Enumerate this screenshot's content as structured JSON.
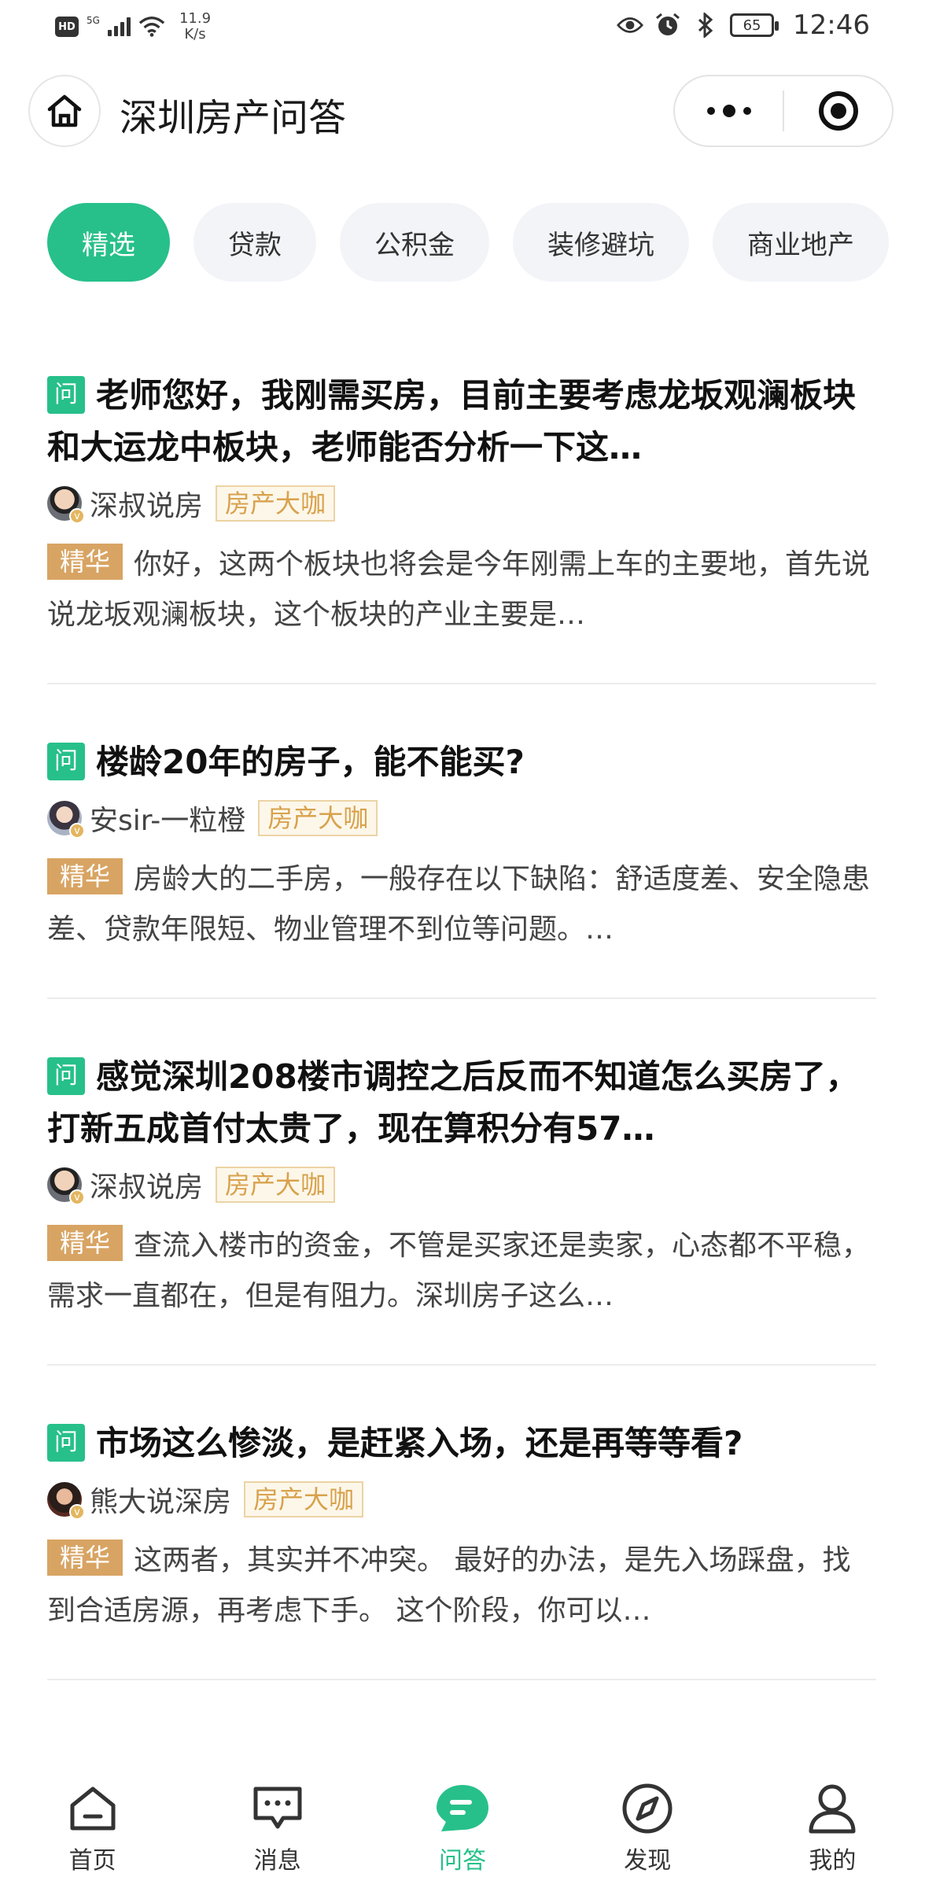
{
  "status_bar": {
    "hd": "HD",
    "network": "5G",
    "speed_value": "11.9",
    "speed_unit": "K/s",
    "battery": "65",
    "time": "12:46"
  },
  "header": {
    "title": "深圳房产问答"
  },
  "tabs": [
    {
      "label": "精选",
      "active": true
    },
    {
      "label": "贷款",
      "active": false
    },
    {
      "label": "公积金",
      "active": false
    },
    {
      "label": "装修避坑",
      "active": false
    },
    {
      "label": "商业地产",
      "active": false
    }
  ],
  "question_badge": "问",
  "featured_badge": "精华",
  "verified_mark": "v",
  "questions": [
    {
      "title": "老师您好，我刚需买房，目前主要考虑龙坂观澜板块和大运龙中板块，老师能否分析一下这…",
      "author": "深叔说房",
      "author_tag": "房产大咖",
      "answer": "你好，这两个板块也将会是今年刚需上车的主要地，首先说说龙坂观澜板块，这个板块的产业主要是…"
    },
    {
      "title": "楼龄20年的房子，能不能买?",
      "author": "安sir-一粒橙",
      "author_tag": "房产大咖",
      "answer": "房龄大的二手房，一般存在以下缺陷：舒适度差、安全隐患差、贷款年限短、物业管理不到位等问题。…"
    },
    {
      "title": "感觉深圳208楼市调控之后反而不知道怎么买房了，打新五成首付太贵了，现在算积分有57…",
      "author": "深叔说房",
      "author_tag": "房产大咖",
      "answer": "查流入楼市的资金，不管是买家还是卖家，心态都不平稳，需求一直都在，但是有阻力。深圳房子这么…"
    },
    {
      "title": "市场这么惨淡，是赶紧入场，还是再等等看?",
      "author": "熊大说深房",
      "author_tag": "房产大咖",
      "answer": "这两者，其实并不冲突。 最好的办法，是先入场踩盘，找到合适房源，再考虑下手。 这个阶段，你可以…"
    }
  ],
  "bottom_nav": [
    {
      "label": "首页",
      "icon": "home-icon",
      "active": false
    },
    {
      "label": "消息",
      "icon": "message-icon",
      "active": false
    },
    {
      "label": "问答",
      "icon": "qa-icon",
      "active": true
    },
    {
      "label": "发现",
      "icon": "compass-icon",
      "active": false
    },
    {
      "label": "我的",
      "icon": "user-icon",
      "active": false
    }
  ],
  "colors": {
    "accent": "#27c08a",
    "featured": "#d8a463",
    "tag_text": "#d8a24c"
  }
}
